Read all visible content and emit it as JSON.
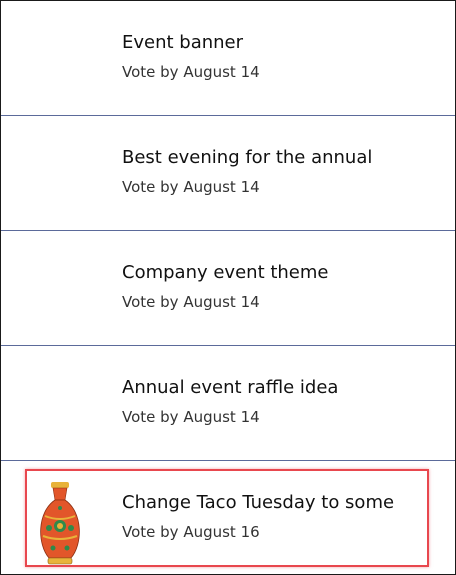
{
  "items": [
    {
      "title": "Event banner",
      "subtitle": "Vote by August 14",
      "has_image": false
    },
    {
      "title": "Best evening for the annual",
      "subtitle": "Vote by August 14",
      "has_image": false
    },
    {
      "title": "Company event theme",
      "subtitle": "Vote by August 14",
      "has_image": false
    },
    {
      "title": "Annual event raffle idea",
      "subtitle": "Vote by August 14",
      "has_image": false
    },
    {
      "title": "Change Taco Tuesday to some",
      "subtitle": "Vote by August 16",
      "has_image": true,
      "image_icon": "vase-image"
    }
  ],
  "colors": {
    "divider": "#5b6a9a",
    "highlight": "#e8474e",
    "vase_body": "#e2562a",
    "vase_pattern": "#2f8a4a",
    "vase_gold": "#e8b33a"
  }
}
